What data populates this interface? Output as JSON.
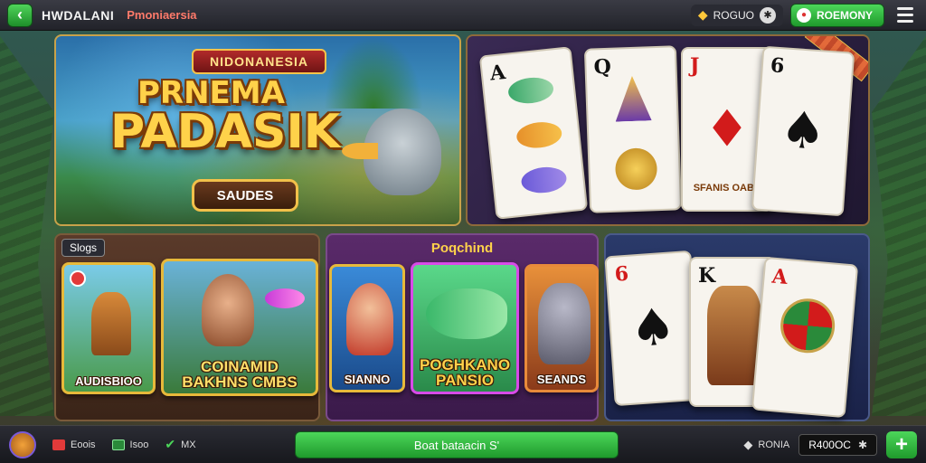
{
  "topbar": {
    "app_name": "HWDALANI",
    "app_sub": "Pmoniaersia",
    "coins_label": "ROGUO",
    "balance_label": "ROEMONY"
  },
  "hero": {
    "tag": "NIDONANESIA",
    "title_line1": "PRNEMA",
    "title_line2": "PADASIK",
    "button_label": "SAUDES"
  },
  "cards_banner": {
    "cards": [
      {
        "rank": "A",
        "suit": "♠",
        "color": "black"
      },
      {
        "rank": "Q",
        "suit": "♠",
        "color": "black"
      },
      {
        "rank": "J",
        "suit": "♦",
        "color": "red"
      },
      {
        "rank": "6",
        "suit": "♠",
        "color": "black"
      }
    ],
    "card3_caption": "SFANIS OABE"
  },
  "slots_panel": {
    "label": "Slogs",
    "tile1_caption": "AUDISBIOO",
    "tile2_caption_line1": "COINAMID",
    "tile2_caption_line2": "BAKHNS CMBS"
  },
  "fishing_panel": {
    "title": "Poqchind",
    "tile1_caption": "SIANNO",
    "tile2_caption_line1": "POGHKANO",
    "tile2_caption_line2": "PANSIO",
    "tile3_caption": "SEANDS"
  },
  "cards_panel2": {
    "cards": [
      {
        "rank": "6",
        "suit": "♠",
        "color": "black"
      },
      {
        "rank": "K",
        "suit": "♠",
        "color": "black"
      },
      {
        "rank": "A",
        "suit": "♦",
        "color": "red"
      }
    ]
  },
  "bottombar": {
    "item1": "Eoois",
    "item2": "Isoo",
    "item3": "MX",
    "play_label": "Boat bataacin S'",
    "right_label": "RONIA",
    "balance_value": "R400OC"
  }
}
